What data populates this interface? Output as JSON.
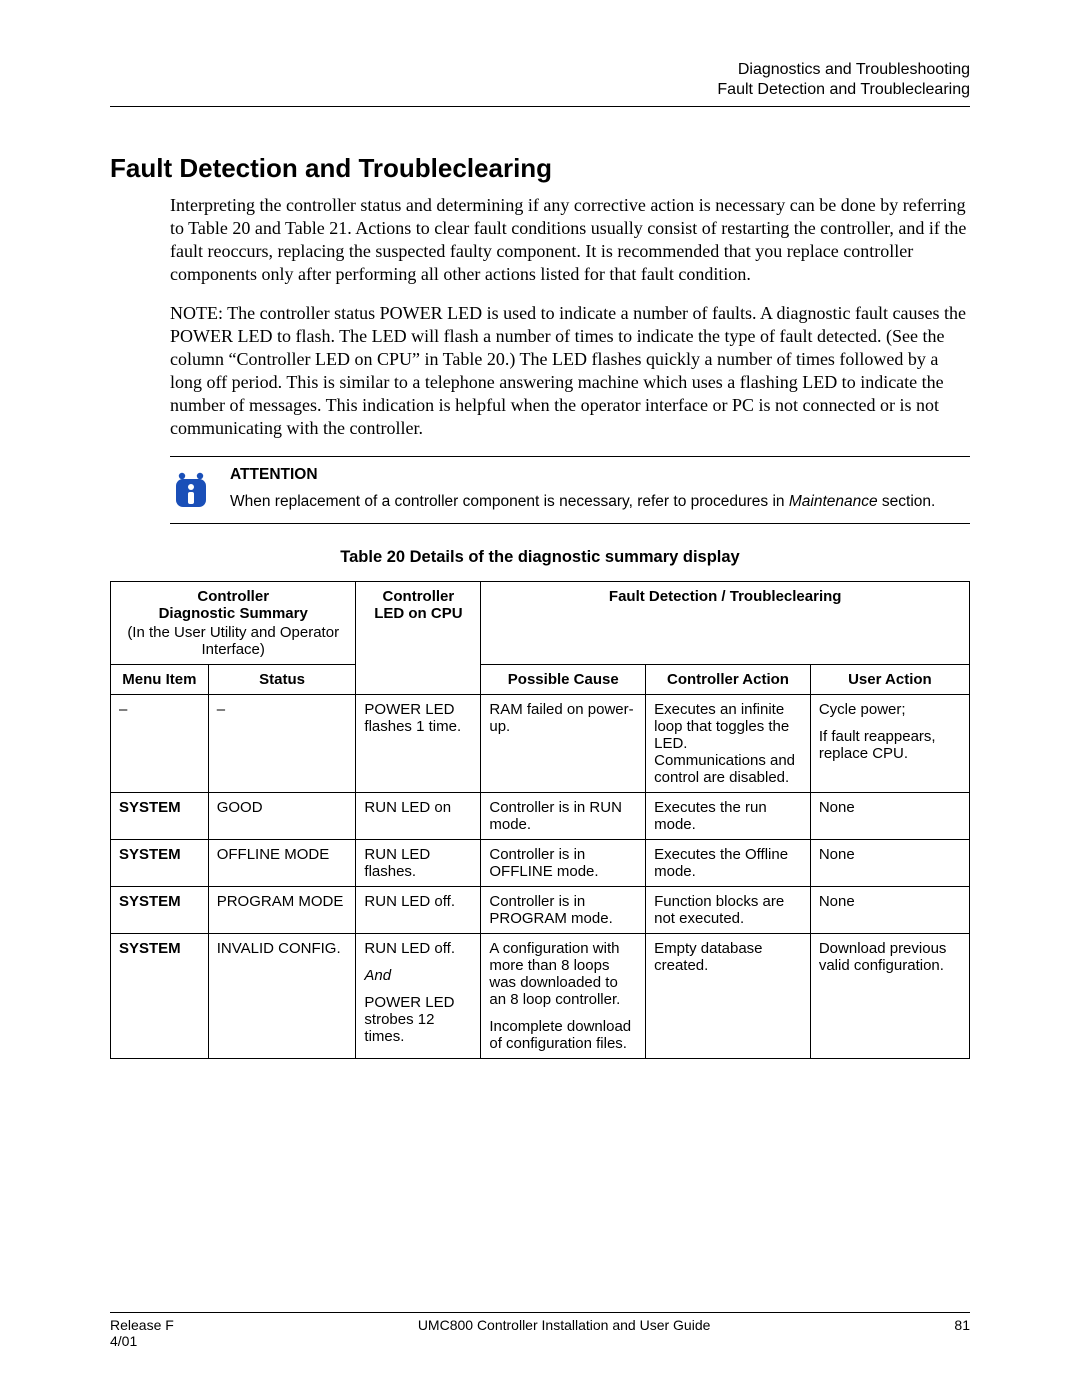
{
  "header": {
    "chapter": "Diagnostics and Troubleshooting",
    "section": "Fault Detection and Troubleclearing"
  },
  "title": "Fault Detection and Troubleclearing",
  "para1": "Interpreting the controller status and determining if any corrective action is necessary can be done by referring to Table 20 and Table 21.  Actions to clear fault conditions usually consist of restarting the controller, and if the fault reoccurs, replacing the suspected faulty component.  It is recommended that you replace controller components only after performing all other actions listed for that fault condition.",
  "para2": "NOTE:  The controller status POWER LED is used to indicate a number of faults.  A diagnostic fault causes the POWER LED to flash.  The LED will flash a number of times to indicate the type of fault detected. (See the column “Controller LED on CPU” in Table 20.)  The LED flashes quickly a number of times followed by a long off period.  This is similar to a telephone answering machine which uses a flashing LED to indicate the number of messages.  This indication is helpful when the operator interface or PC is not connected or is not communicating with the controller.",
  "attention": {
    "label": "ATTENTION",
    "body_pre": "When replacement of a controller component is necessary, refer to procedures in ",
    "body_italic": "Maintenance",
    "body_post": " section.",
    "icon_name": "information-icon"
  },
  "table": {
    "caption": "Table 20  Details of the diagnostic summary display",
    "head": {
      "group1_line1": "Controller",
      "group1_line2": "Diagnostic Summary",
      "group1_sub": "(In the User Utility and Operator Interface)",
      "group2_line1": "Controller",
      "group2_line2": "LED on CPU",
      "group3": "Fault Detection / Troubleclearing",
      "menu": "Menu Item",
      "status": "Status",
      "cause": "Possible Cause",
      "ctrl": "Controller Action",
      "user": "User Action"
    },
    "rows": [
      {
        "menu": "–",
        "status": "–",
        "led": "POWER LED flashes 1 time.",
        "cause": "RAM failed on power-up.",
        "ctrl": "Executes an infinite loop that toggles the LED. Communications and control are disabled.",
        "user_a": "Cycle power;",
        "user_b": "If fault reappears, replace CPU."
      },
      {
        "menu": "SYSTEM",
        "status": "GOOD",
        "led": "RUN LED on",
        "cause": "Controller is in RUN mode.",
        "ctrl": "Executes the run mode.",
        "user_a": "None",
        "user_b": ""
      },
      {
        "menu": "SYSTEM",
        "status": "OFFLINE MODE",
        "led": "RUN LED flashes.",
        "cause": "Controller is in OFFLINE mode.",
        "ctrl": "Executes the Offline mode.",
        "user_a": "None",
        "user_b": ""
      },
      {
        "menu": "SYSTEM",
        "status": "PROGRAM MODE",
        "led": "RUN LED off.",
        "cause": "Controller is in PROGRAM mode.",
        "ctrl": "Function blocks are not executed.",
        "user_a": "None",
        "user_b": ""
      },
      {
        "menu": "SYSTEM",
        "status": "INVALID CONFIG.",
        "led_a": "RUN LED off.",
        "led_and": "And",
        "led_b": "POWER LED strobes 12 times.",
        "cause_a": "A configuration with more than 8 loops was downloaded to an 8 loop controller.",
        "cause_b": "Incomplete download of configuration files.",
        "ctrl": "Empty database created.",
        "user_a": "Download previous valid configuration.",
        "user_b": ""
      }
    ]
  },
  "footer": {
    "left1": "Release F",
    "left2": "4/01",
    "center": "UMC800 Controller Installation and User Guide",
    "right": "81"
  }
}
